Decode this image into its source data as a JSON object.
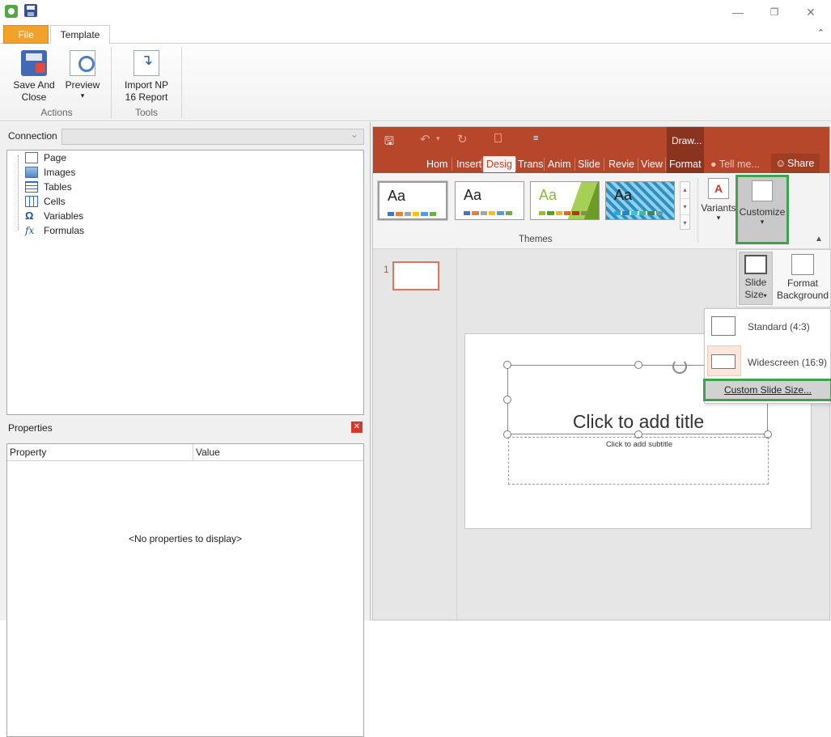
{
  "window": {
    "minimize_glyph": "—",
    "restore_glyph": "❐",
    "close_glyph": "✕"
  },
  "ribbon_tabs": {
    "file": "File",
    "template": "Template",
    "collapse_glyph": "⌃"
  },
  "ribbon": {
    "save_close": [
      "Save And",
      "Close"
    ],
    "preview": "Preview",
    "preview_caret": "▾",
    "import": [
      "Import NP",
      "16 Report"
    ],
    "group_actions": "Actions",
    "group_tools": "Tools"
  },
  "left": {
    "connection_label": "Connection",
    "connection_value": "",
    "tree": [
      "Page",
      "Images",
      "Tables",
      "Cells",
      "Variables",
      "Formulas"
    ],
    "tree_icons": [
      "page-icon",
      "images-icon",
      "tables-icon",
      "cells-icon",
      "variables-icon",
      "formulas-icon"
    ],
    "var_glyph": "Ω",
    "fx_glyph": "fx",
    "properties_title": "Properties",
    "properties_close": "✕",
    "col_property": "Property",
    "col_value": "Value",
    "empty_text": "<No properties to display>"
  },
  "ppt": {
    "qat_save": "🖫",
    "qat_undo": "↶",
    "qat_undo_caret": "▾",
    "qat_redo": "↻",
    "qat_present": "⎕",
    "qat_more": "≡",
    "context_label": "Draw...",
    "tabs": [
      "Hom",
      "Insert",
      "Desig",
      "Trans",
      "Anim",
      "Slide",
      "Revie",
      "View",
      "Format"
    ],
    "tell_me": "Tell me...",
    "share": "Share",
    "theme_aa": "Aa",
    "themes_label": "Themes",
    "variants_label": "Variants",
    "customize_label": "Customize",
    "caret": "▾",
    "gallery_up": "▴",
    "gallery_down": "▾",
    "gallery_more": "▾",
    "slide_number": "1",
    "slide_size_label": [
      "Slide",
      "Size"
    ],
    "format_background_label": [
      "Format",
      "Background"
    ],
    "size_options": [
      "Standard (4:3)",
      "Widescreen (16:9)"
    ],
    "custom_size": "Custom Slide Size...",
    "title_placeholder": "Click to add title",
    "subtitle_placeholder": "Click to add subtitle",
    "accent_color": "#b7472a",
    "highlight_color": "#3fa34d"
  }
}
